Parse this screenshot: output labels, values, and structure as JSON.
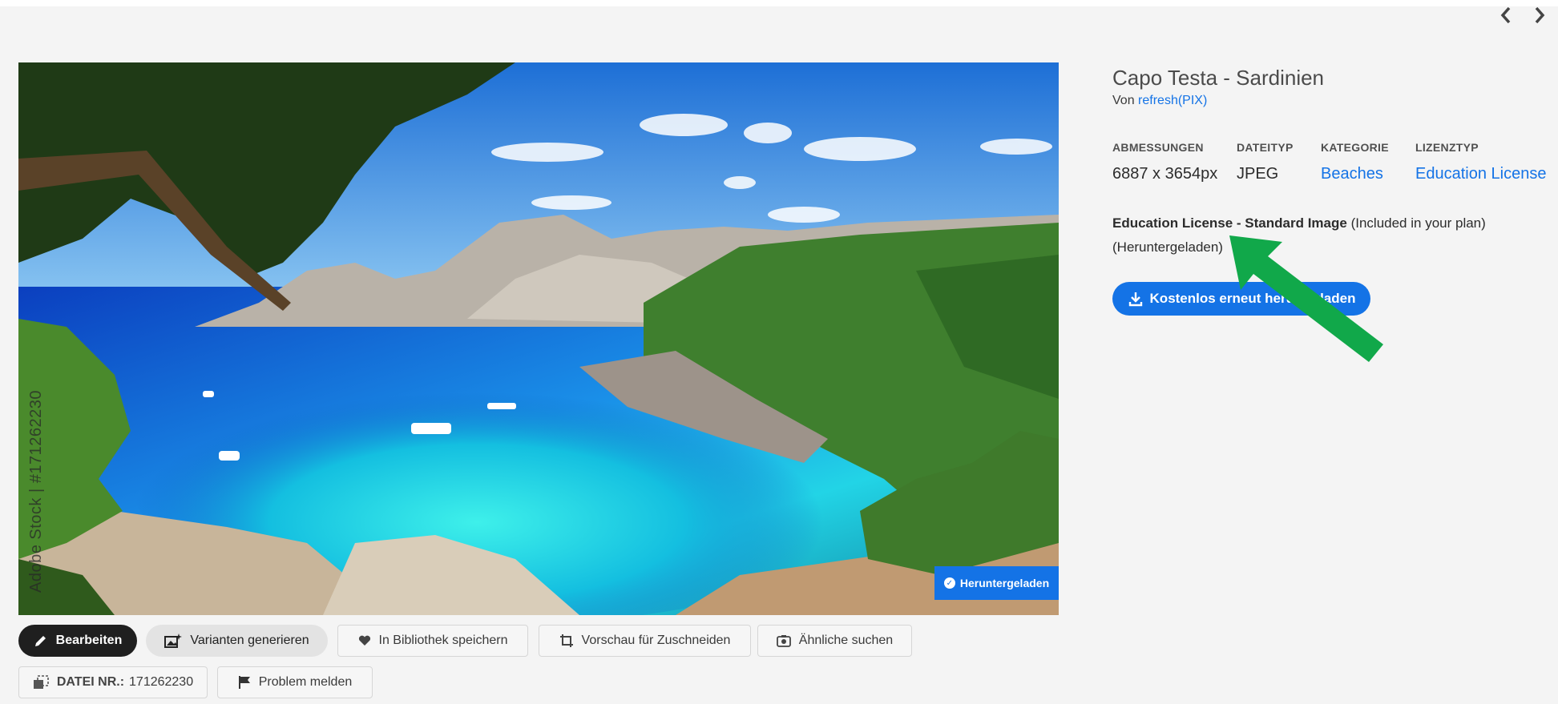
{
  "nav": {
    "prev_icon": "chevron-left-icon",
    "next_icon": "chevron-right-icon"
  },
  "image": {
    "watermark": "Adobe Stock | #171262230",
    "badge_label": "Heruntergeladen"
  },
  "actions": {
    "edit": "Bearbeiten",
    "variants": "Varianten generieren",
    "save_library": "In Bibliothek speichern",
    "crop_preview": "Vorschau für Zuschneiden",
    "find_similar": "Ähnliche suchen",
    "file_label": "DATEI NR.:",
    "file_number": "171262230",
    "report": "Problem melden"
  },
  "asset": {
    "title": "Capo Testa - Sardinien",
    "by_prefix": "Von",
    "author": "refresh(PIX)"
  },
  "meta": [
    {
      "label": "ABMESSUNGEN",
      "value": "6887 x 3654px",
      "link": false
    },
    {
      "label": "DATEITYP",
      "value": "JPEG",
      "link": false
    },
    {
      "label": "KATEGORIE",
      "value": "Beaches",
      "link": true
    },
    {
      "label": "LIZENZTYP",
      "value": "Education License",
      "link": true
    }
  ],
  "license": {
    "name": "Education License - Standard Image",
    "plan_note": "(Included in your plan)",
    "status": "(Heruntergeladen)"
  },
  "cta": {
    "label": "Kostenlos erneut herunterladen"
  },
  "colors": {
    "accent": "#1473e6",
    "annotation_arrow": "#11a84a"
  }
}
